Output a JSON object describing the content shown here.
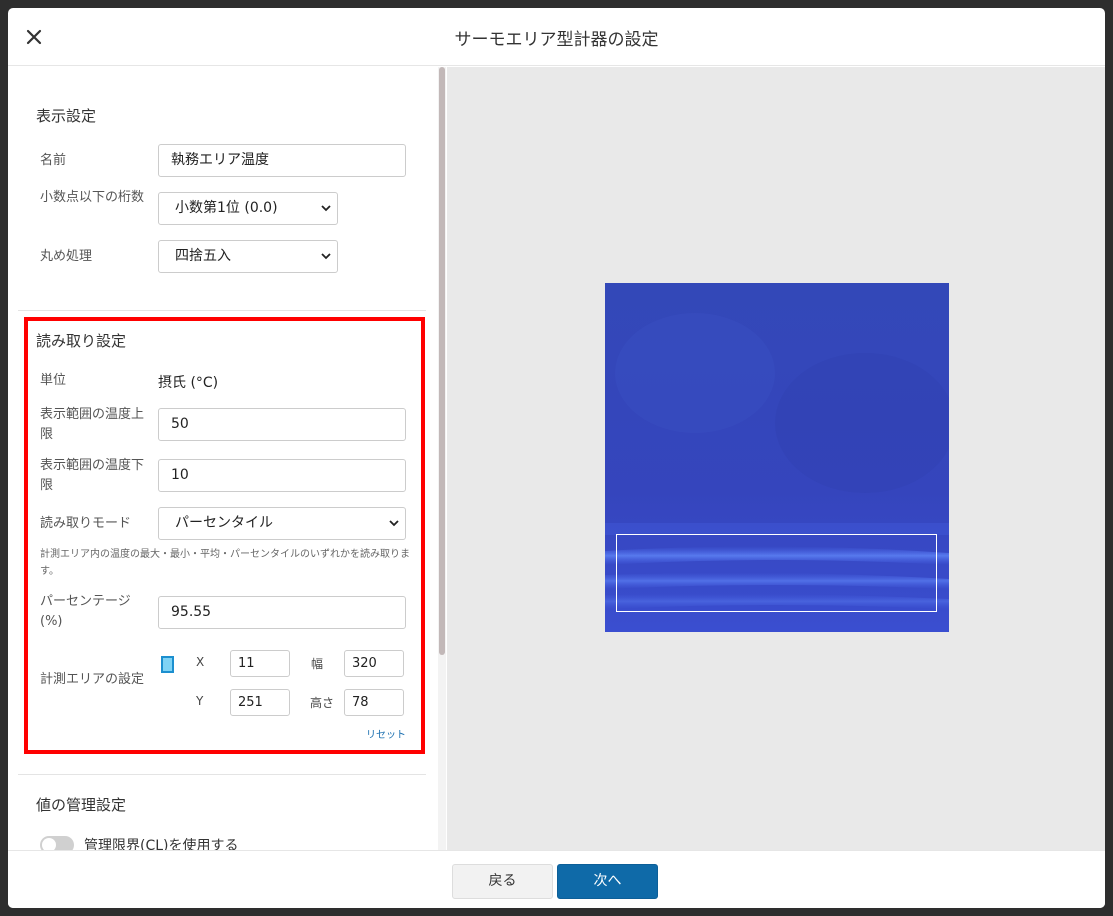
{
  "dialog": {
    "title": "サーモエリア型計器の設定",
    "close_icon": "close-icon"
  },
  "display_settings": {
    "heading": "表示設定",
    "name_label": "名前",
    "name_value": "執務エリア温度",
    "decimals_label": "小数点以下の桁数",
    "decimals_value": "小数第1位 (0.0)",
    "rounding_label": "丸め処理",
    "rounding_value": "四捨五入"
  },
  "read_settings": {
    "heading": "読み取り設定",
    "unit_label": "単位",
    "unit_value": "摂氏 (°C)",
    "upper_label": "表示範囲の温度上限",
    "upper_value": "50",
    "lower_label": "表示範囲の温度下限",
    "lower_value": "10",
    "mode_label": "読み取りモード",
    "mode_value": "パーセンタイル",
    "mode_note": "計測エリア内の温度の最大・最小・平均・パーセンタイルのいずれかを読み取ります。",
    "percent_label": "パーセンテージ(%)",
    "percent_value": "95.55",
    "area_label": "計測エリアの設定",
    "x_label": "X",
    "x_value": "11",
    "y_label": "Y",
    "y_value": "251",
    "w_label": "幅",
    "w_value": "320",
    "h_label": "高さ",
    "h_value": "78",
    "reset_label": "リセット"
  },
  "value_management": {
    "heading": "値の管理設定",
    "cl_toggle_label": "管理限界(CL)を使用する",
    "cl_enabled": false
  },
  "footer": {
    "back_label": "戻る",
    "next_label": "次へ"
  },
  "colors": {
    "accent": "#0f6aa8",
    "highlight_border": "#ff0000",
    "preview_blue": "#3544b8"
  }
}
